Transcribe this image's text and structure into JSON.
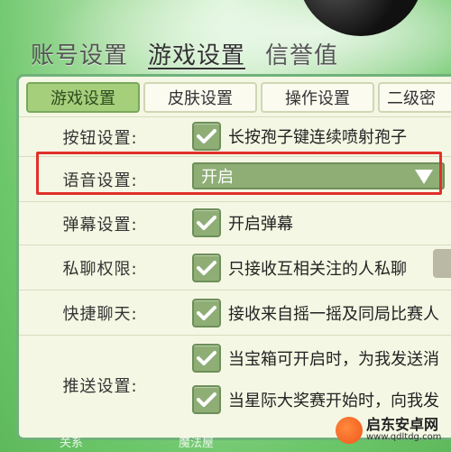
{
  "top_tabs": [
    "账号设置",
    "游戏设置",
    "信誉值"
  ],
  "sub_tabs": [
    "游戏设置",
    "皮肤设置",
    "操作设置",
    "二级密"
  ],
  "rows": {
    "button": {
      "label": "按钮设置:",
      "option": "长按孢子键连续喷射孢子"
    },
    "voice": {
      "label": "语音设置:",
      "value": "开启"
    },
    "danmaku": {
      "label": "弹幕设置:",
      "option": "开启弹幕"
    },
    "private": {
      "label": "私聊权限:",
      "option": "只接收互相关注的人私聊"
    },
    "quickchat": {
      "label": "快捷聊天:",
      "option": "接收来自摇一摇及同局比赛人"
    },
    "push": {
      "label": "推送设置:",
      "options": [
        "当宝箱可开启时，为我发送消",
        "当星际大奖赛开始时，向我发"
      ]
    }
  },
  "bottom": [
    "关系",
    "魔法屋"
  ],
  "watermark": {
    "title": "启东安卓网",
    "url": "www.qdltdg.com"
  },
  "colors": {
    "accent": "#a6cf7c",
    "highlight": "#e0312a",
    "control": "#8eae76"
  }
}
